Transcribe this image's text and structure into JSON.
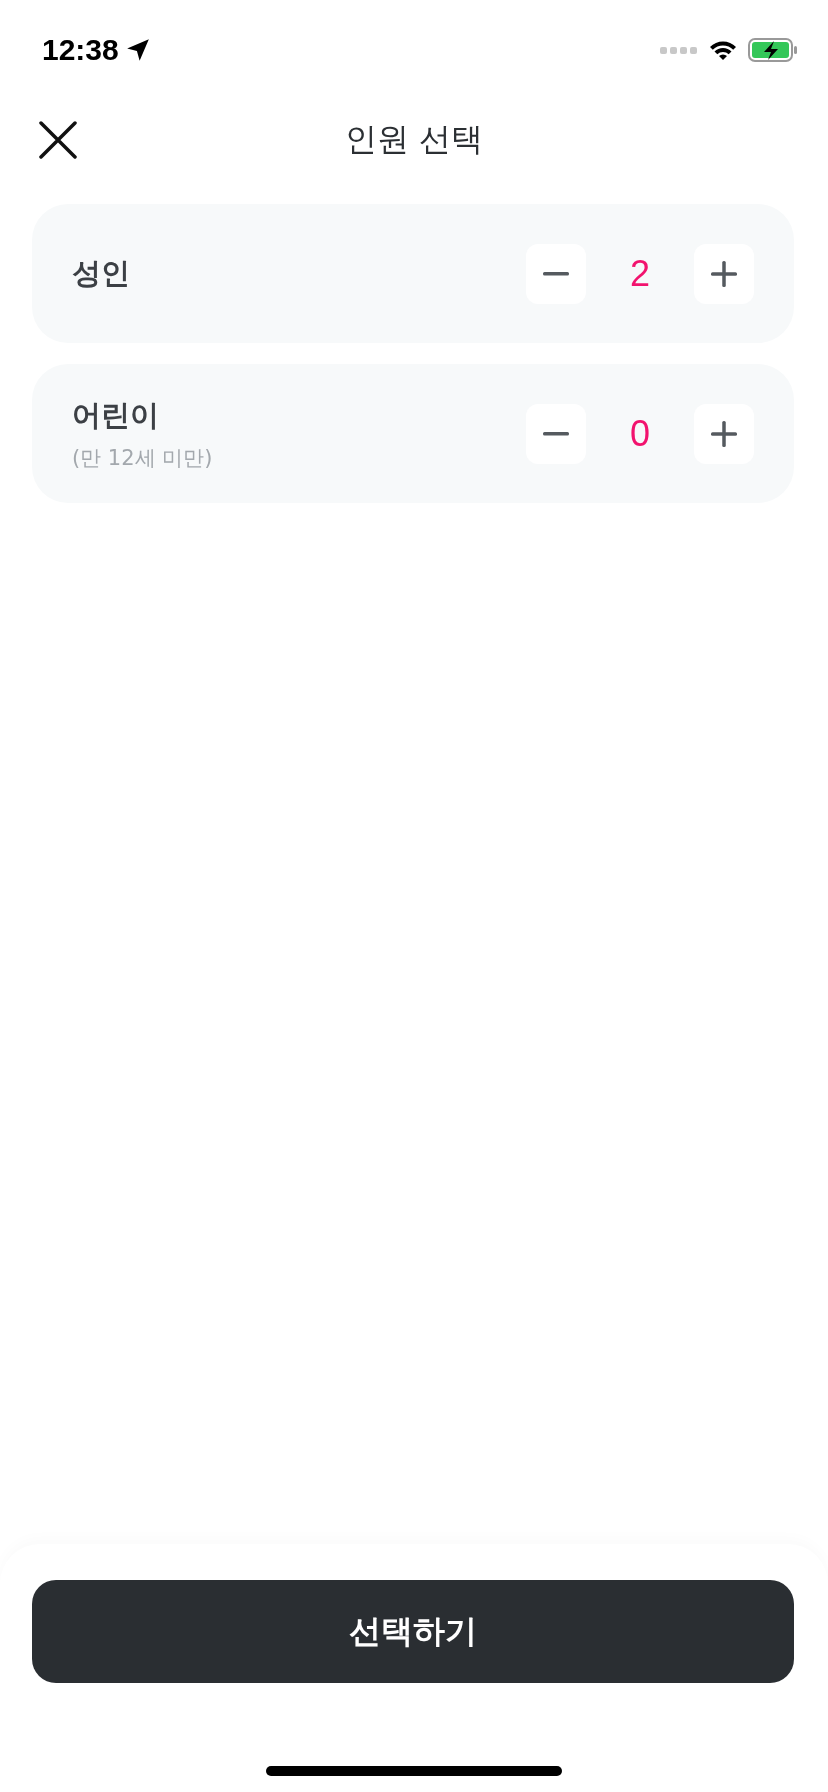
{
  "status_bar": {
    "time": "12:38"
  },
  "header": {
    "title": "인원 선택"
  },
  "counters": [
    {
      "label": "성인",
      "count": "2"
    },
    {
      "label": "어린이",
      "note": "(만 12세 미만)",
      "count": "0"
    }
  ],
  "confirm_button": {
    "label": "선택하기"
  }
}
